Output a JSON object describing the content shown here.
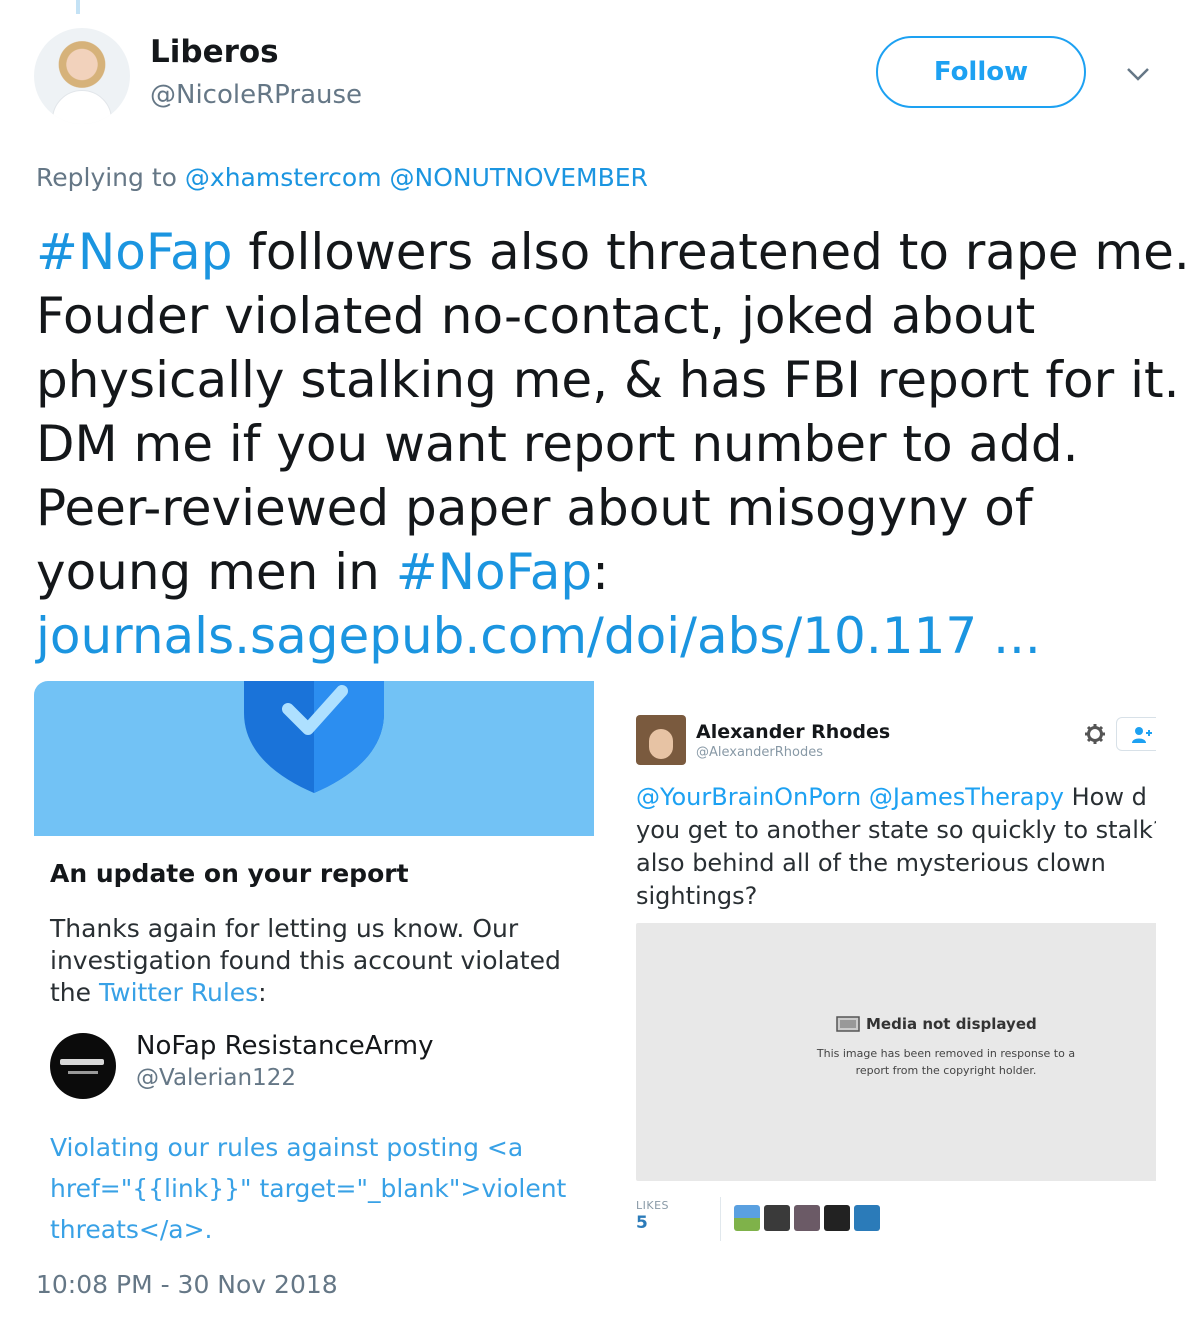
{
  "tweet": {
    "display_name": "Liberos",
    "handle": "@NicoleRPrause",
    "follow_label": "Follow",
    "replying_prefix": "Replying to",
    "replying_mentions": [
      "@xhamstercom",
      "@NONUTNOVEMBER"
    ],
    "text": {
      "hashtag1": "#NoFap",
      "line1_rest": " followers also threatened to rape me.",
      "line2": "Fouder violated no-contact, joked about",
      "line3": "physically stalking me, & has FBI report for it.",
      "line4": "DM me if you want report number to add.",
      "line5": "Peer-reviewed paper about misogyny of",
      "line6_prefix": "young men in ",
      "hashtag2": "#NoFap",
      "line6_suffix": ":",
      "link": "journals.sagepub.com/doi/abs/10.117 ..."
    },
    "timestamp": "10:08 PM - 30 Nov 2018"
  },
  "report_card": {
    "title": "An update on your report",
    "body_line1": "Thanks again for letting us know. Our",
    "body_line2": "investigation found this account violated",
    "body_line3_prefix": "the ",
    "body_link": "Twitter Rules",
    "body_line3_suffix": ":",
    "account_name": "NoFap ResistanceArmy",
    "account_handle": "@Valerian122",
    "violation_line1": "Violating our rules against posting <a",
    "violation_line2": "href=\"{{link}}\" target=\"_blank\">violent",
    "violation_line3": "threats</a>.",
    "colors": {
      "banner": "#72c2f5",
      "shield": "#1a73d9"
    }
  },
  "embedded_tweet": {
    "name": "Alexander Rhodes",
    "handle": "@AlexanderRhodes",
    "mention1": "@YourBrainOnPorn",
    "mention2": "@JamesTherapy",
    "line1_rest": " How d",
    "line2": "you get to another state so quickly to stalk?",
    "line3": "also behind all of the mysterious clown",
    "line4": "sightings?",
    "media_title": "Media not displayed",
    "media_desc_line1": "This image has been removed in response to a",
    "media_desc_line2": "report from the copyright holder.",
    "likes_label": "LIKES",
    "likes_count": "5"
  },
  "colors": {
    "link": "#1b95e0",
    "follow": "#1da1f2",
    "muted": "#657786"
  },
  "icons": [
    "chevron-down-icon",
    "gear-icon",
    "follow-user-icon",
    "shield-check-icon",
    "image-icon"
  ]
}
